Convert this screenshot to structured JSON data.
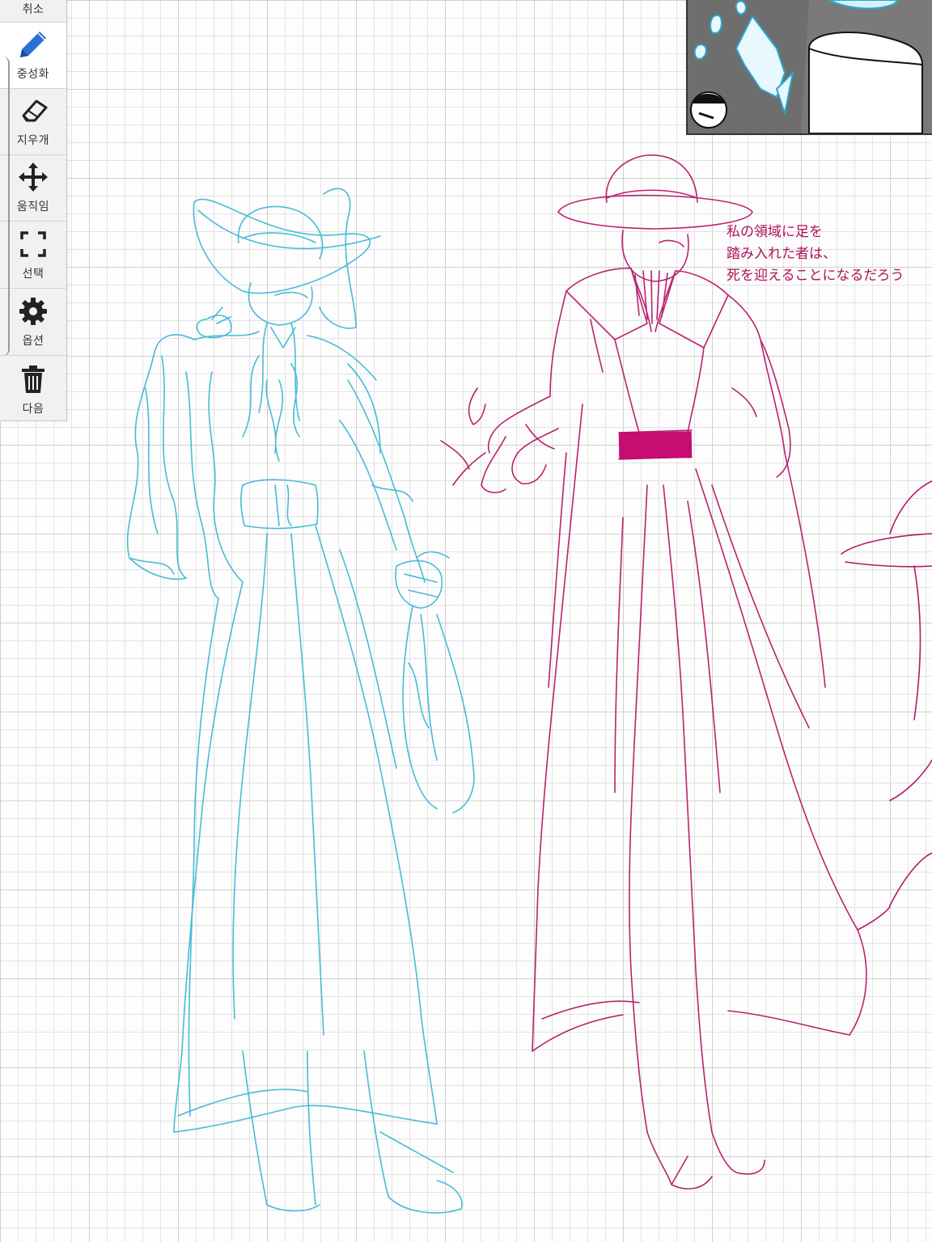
{
  "toolbar": {
    "undo_label": "취소",
    "pen_label": "중성화",
    "eraser_label": "지우개",
    "move_label": "움직임",
    "select_label": "선택",
    "options_label": "옵션",
    "next_label": "다음"
  },
  "annotation": {
    "line1": "私の領域に足を",
    "line2": "踏み入れた者は、",
    "line3": "死を迎えることになるだろう"
  },
  "colors": {
    "blue_sketch": "#3fb8d6",
    "magenta_sketch": "#b8176a",
    "belt": "#c4006a",
    "annotation": "#b0105a"
  }
}
